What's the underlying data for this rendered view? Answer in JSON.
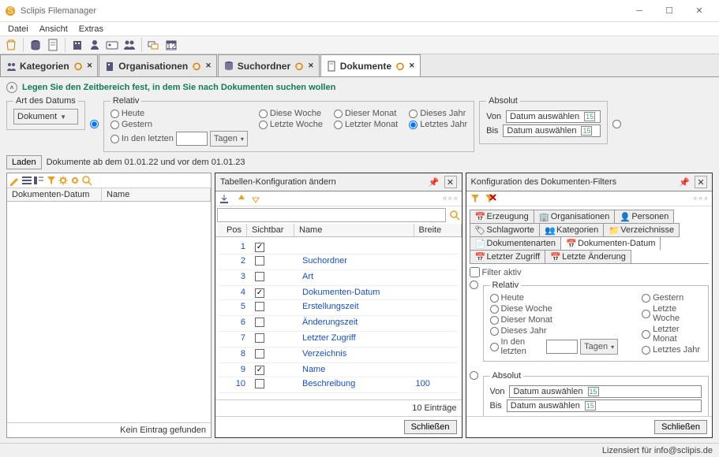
{
  "window": {
    "title": "Sclipis Filemanager"
  },
  "menu": {
    "datei": "Datei",
    "ansicht": "Ansicht",
    "extras": "Extras"
  },
  "tabs": {
    "kategorien": "Kategorien",
    "organisationen": "Organisationen",
    "suchordner": "Suchordner",
    "dokumente": "Dokumente"
  },
  "expander": {
    "hint": "Legen Sie den Zeitbereich fest, in dem Sie nach Dokumenten suchen wollen"
  },
  "datetype": {
    "legend": "Art des Datums",
    "value": "Dokument"
  },
  "relativ": {
    "legend": "Relativ",
    "heute": "Heute",
    "gestern": "Gestern",
    "dieseWoche": "Diese Woche",
    "letzteWoche": "Letzte Woche",
    "dieserMonat": "Dieser Monat",
    "letzterMonat": "Letzter Monat",
    "diesesJahr": "Dieses Jahr",
    "letztesJahr": "Letztes Jahr",
    "inDenLetzten": "In den letzten",
    "tagen": "Tagen"
  },
  "absolut": {
    "legend": "Absolut",
    "von": "Von",
    "bis": "Bis",
    "placeholder": "Datum auswählen"
  },
  "load": {
    "button": "Laden",
    "text": "Dokumente ab dem 01.01.22 und vor dem 01.01.23"
  },
  "leftcols": {
    "date": "Dokumenten-Datum",
    "name": "Name",
    "footer": "Kein Eintrag gefunden"
  },
  "tableDlg": {
    "title": "Tabellen-Konfiguration ändern",
    "cols": {
      "pos": "Pos",
      "sichtbar": "Sichtbar",
      "name": "Name",
      "breite": "Breite"
    },
    "rows": [
      {
        "pos": "1",
        "on": true,
        "name": "",
        "breite": ""
      },
      {
        "pos": "2",
        "on": false,
        "name": "Suchordner",
        "breite": ""
      },
      {
        "pos": "3",
        "on": false,
        "name": "Art",
        "breite": ""
      },
      {
        "pos": "4",
        "on": true,
        "name": "Dokumenten-Datum",
        "breite": ""
      },
      {
        "pos": "5",
        "on": false,
        "name": "Erstellungszeit",
        "breite": ""
      },
      {
        "pos": "6",
        "on": false,
        "name": "Änderungszeit",
        "breite": ""
      },
      {
        "pos": "7",
        "on": false,
        "name": "Letzter Zugriff",
        "breite": ""
      },
      {
        "pos": "8",
        "on": false,
        "name": "Verzeichnis",
        "breite": ""
      },
      {
        "pos": "9",
        "on": true,
        "name": "Name",
        "breite": ""
      },
      {
        "pos": "10",
        "on": false,
        "name": "Beschreibung",
        "breite": "100"
      }
    ],
    "count": "10 Einträge",
    "close": "Schließen"
  },
  "filterDlg": {
    "title": "Konfiguration des Dokumenten-Filters",
    "tabs": {
      "erzeugung": "Erzeugung",
      "organisationen": "Organisationen",
      "personen": "Personen",
      "schlagworte": "Schlagworte",
      "kategorien": "Kategorien",
      "verzeichnisse": "Verzeichnisse",
      "dokumentenarten": "Dokumentenarten",
      "dokDatum": "Dokumenten-Datum",
      "letzterZugriff": "Letzter Zugriff",
      "letzteAenderung": "Letzte Änderung"
    },
    "filterAktiv": "Filter aktiv",
    "close": "Schließen"
  },
  "status": {
    "licensed": "Lizensiert für info@sclipis.de"
  }
}
